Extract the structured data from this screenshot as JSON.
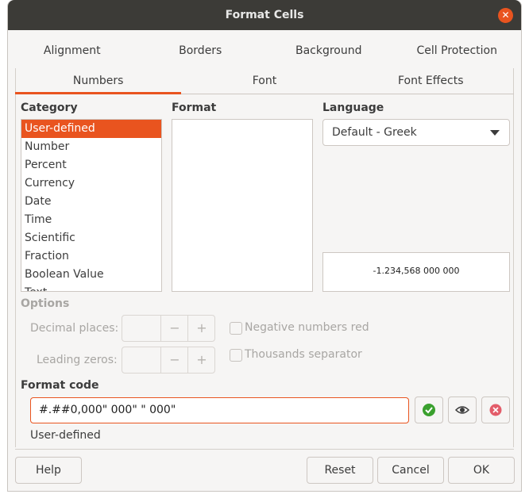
{
  "window": {
    "title": "Format Cells"
  },
  "top_tabs": [
    "Alignment",
    "Borders",
    "Background",
    "Cell Protection"
  ],
  "sub_tabs": [
    "Numbers",
    "Font",
    "Font Effects"
  ],
  "category": {
    "label": "Category",
    "items": [
      "User-defined",
      "Number",
      "Percent",
      "Currency",
      "Date",
      "Time",
      "Scientific",
      "Fraction",
      "Boolean Value",
      "Text"
    ],
    "selected": "User-defined"
  },
  "format": {
    "label": "Format"
  },
  "language": {
    "label": "Language",
    "value": "Default - Greek"
  },
  "preview": {
    "text": "-1.234,568 000  000"
  },
  "options": {
    "label": "Options",
    "decimal_places": "Decimal places:",
    "leading_zeros": "Leading zeros:",
    "negative_red": "Negative numbers red",
    "thousands_sep": "Thousands separator",
    "spin_minus": "−",
    "spin_plus": "+"
  },
  "format_code": {
    "label": "Format code",
    "value": "#.##0,000\" 000\" \" 000\"",
    "description": "User-defined"
  },
  "buttons": {
    "help": "Help",
    "reset": "Reset",
    "cancel": "Cancel",
    "ok": "OK"
  },
  "colors": {
    "accent": "#e9541f",
    "titlebar": "#3c3b37",
    "ok_green": "#3aa02e",
    "delete_red": "#e35d6a"
  }
}
